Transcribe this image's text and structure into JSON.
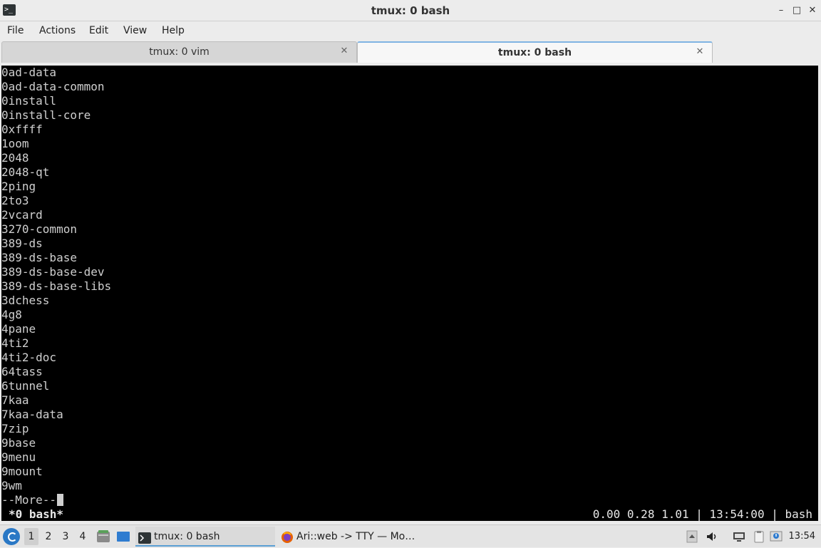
{
  "window": {
    "title": "tmux: 0 bash",
    "minimize": "–",
    "maximize": "□",
    "close": "✕"
  },
  "menu": [
    "File",
    "Actions",
    "Edit",
    "View",
    "Help"
  ],
  "tabs": [
    {
      "label": "tmux: 0 vim",
      "active": false
    },
    {
      "label": "tmux: 0 bash",
      "active": true
    }
  ],
  "terminal": {
    "lines": [
      "0ad-data",
      "0ad-data-common",
      "0install",
      "0install-core",
      "0xffff",
      "1oom",
      "2048",
      "2048-qt",
      "2ping",
      "2to3",
      "2vcard",
      "3270-common",
      "389-ds",
      "389-ds-base",
      "389-ds-base-dev",
      "389-ds-base-libs",
      "3dchess",
      "4g8",
      "4pane",
      "4ti2",
      "4ti2-doc",
      "64tass",
      "6tunnel",
      "7kaa",
      "7kaa-data",
      "7zip",
      "9base",
      "9menu",
      "9mount",
      "9wm"
    ],
    "pager_prompt": "--More--",
    "status_left": "*0 bash*",
    "status_right": "0.00 0.28 1.01 | 13:54:00 | bash"
  },
  "taskbar": {
    "workspaces": [
      "1",
      "2",
      "3",
      "4"
    ],
    "active_workspace": "1",
    "tasks": [
      {
        "label": "tmux: 0 bash",
        "icon": "terminal-icon",
        "active": true
      },
      {
        "label": "Ari::web -> TTY — Mo…",
        "icon": "firefox-icon",
        "active": false
      }
    ],
    "clock": "13:54"
  },
  "colors": {
    "terminal_bg": "#000000",
    "terminal_fg": "#cfcfcf",
    "accent": "#5a9fd4"
  }
}
